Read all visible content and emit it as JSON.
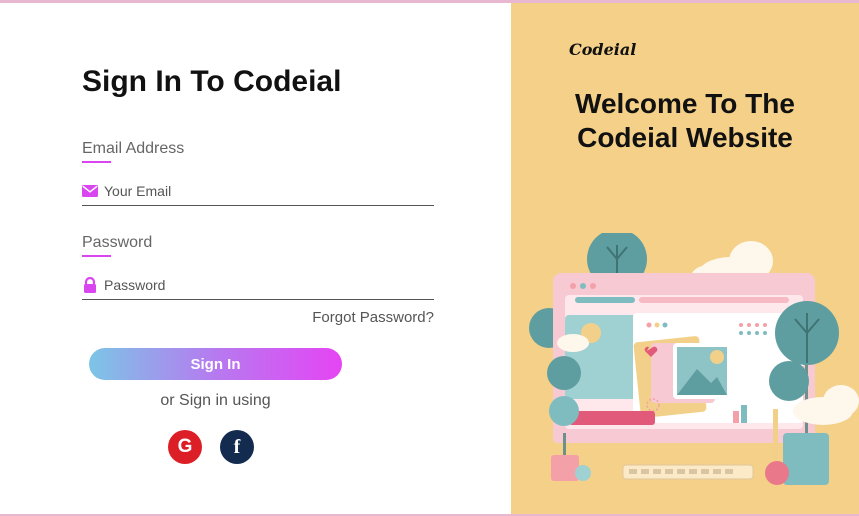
{
  "login": {
    "title": "Sign In To Codeial",
    "email_label": "Email Address",
    "email_placeholder": "Your Email",
    "password_label": "Password",
    "password_placeholder": "Password",
    "forgot": "Forgot Password?",
    "signin_button": "Sign In",
    "alt_text": "or Sign in using",
    "google": "G",
    "facebook": "f"
  },
  "promo": {
    "logo": "Codeial",
    "headline_line1": "Welcome To The",
    "headline_line2": "Codeial Website"
  },
  "icons": {
    "email": "envelope-icon",
    "password": "lock-icon",
    "google": "google-icon",
    "facebook": "facebook-icon"
  },
  "colors": {
    "accent": "#d946ef",
    "panel": "#f4d088",
    "google": "#dc1f26",
    "facebook": "#122b4f"
  }
}
